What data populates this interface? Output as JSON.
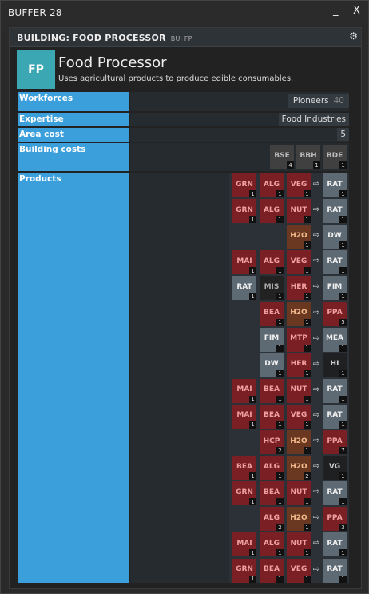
{
  "window": {
    "title": "BUFFER 28",
    "minimize": "_",
    "close": "X"
  },
  "panel": {
    "title": "BUILDING: FOOD PROCESSOR",
    "code": "BUI FP"
  },
  "building": {
    "ticker": "FP",
    "name": "Food Processor",
    "description": "Uses agricultural products to produce edible consumables."
  },
  "labels": {
    "workforces": "Workforces",
    "expertise": "Expertise",
    "area_cost": "Area cost",
    "building_costs": "Building costs",
    "products": "Products"
  },
  "workforce": {
    "name": "Pioneers",
    "count": "40"
  },
  "expertise": "Food Industries",
  "area_cost": "5",
  "building_costs": [
    {
      "t": "BSE",
      "q": "4"
    },
    {
      "t": "BBH",
      "q": "1"
    },
    {
      "t": "BDE",
      "q": "1"
    }
  ],
  "arrow": "⇨",
  "colors": {
    "agri": "#7a1f24",
    "food": "#5e6a73",
    "water": "#6a3820",
    "mis": "#222",
    "hi": "#1e2022",
    "vg": "#1e2022",
    "construction": "#404040",
    "label_bg": "#3b9fdb",
    "ticker_bg": "#3aa7b3"
  },
  "recipes": [
    {
      "inputs": [
        {
          "t": "GRN",
          "q": "1",
          "c": "agri"
        },
        {
          "t": "ALG",
          "q": "1",
          "c": "agri"
        },
        {
          "t": "VEG",
          "q": "1",
          "c": "agri"
        }
      ],
      "output": {
        "t": "RAT",
        "q": "1",
        "c": "food"
      }
    },
    {
      "inputs": [
        {
          "t": "GRN",
          "q": "1",
          "c": "agri"
        },
        {
          "t": "ALG",
          "q": "1",
          "c": "agri"
        },
        {
          "t": "NUT",
          "q": "1",
          "c": "agri"
        }
      ],
      "output": {
        "t": "RAT",
        "q": "1",
        "c": "food"
      }
    },
    {
      "inputs": [
        {
          "t": "H2O",
          "q": "1",
          "c": "water"
        }
      ],
      "output": {
        "t": "DW",
        "q": "1",
        "c": "food"
      }
    },
    {
      "inputs": [
        {
          "t": "MAI",
          "q": "1",
          "c": "agri"
        },
        {
          "t": "ALG",
          "q": "1",
          "c": "agri"
        },
        {
          "t": "VEG",
          "q": "1",
          "c": "agri"
        }
      ],
      "output": {
        "t": "RAT",
        "q": "1",
        "c": "food"
      }
    },
    {
      "inputs": [
        {
          "t": "RAT",
          "q": "1",
          "c": "food"
        },
        {
          "t": "MIS",
          "q": "1",
          "c": "mis"
        },
        {
          "t": "HER",
          "q": "1",
          "c": "agri"
        }
      ],
      "output": {
        "t": "FIM",
        "q": "1",
        "c": "food"
      }
    },
    {
      "inputs": [
        {
          "t": "BEA",
          "q": "1",
          "c": "agri"
        },
        {
          "t": "H2O",
          "q": "1",
          "c": "water"
        }
      ],
      "output": {
        "t": "PPA",
        "q": "5",
        "c": "agri"
      }
    },
    {
      "inputs": [
        {
          "t": "FIM",
          "q": "1",
          "c": "food"
        },
        {
          "t": "MTP",
          "q": "1",
          "c": "agri"
        }
      ],
      "output": {
        "t": "MEA",
        "q": "1",
        "c": "food"
      }
    },
    {
      "inputs": [
        {
          "t": "DW",
          "q": "1",
          "c": "food"
        },
        {
          "t": "HER",
          "q": "1",
          "c": "agri"
        }
      ],
      "output": {
        "t": "HI",
        "q": "1",
        "c": "hi"
      }
    },
    {
      "inputs": [
        {
          "t": "MAI",
          "q": "1",
          "c": "agri"
        },
        {
          "t": "BEA",
          "q": "1",
          "c": "agri"
        },
        {
          "t": "NUT",
          "q": "1",
          "c": "agri"
        }
      ],
      "output": {
        "t": "RAT",
        "q": "1",
        "c": "food"
      }
    },
    {
      "inputs": [
        {
          "t": "MAI",
          "q": "1",
          "c": "agri"
        },
        {
          "t": "BEA",
          "q": "1",
          "c": "agri"
        },
        {
          "t": "VEG",
          "q": "1",
          "c": "agri"
        }
      ],
      "output": {
        "t": "RAT",
        "q": "1",
        "c": "food"
      }
    },
    {
      "inputs": [
        {
          "t": "HCP",
          "q": "2",
          "c": "agri"
        },
        {
          "t": "H2O",
          "q": "1",
          "c": "water"
        }
      ],
      "output": {
        "t": "PPA",
        "q": "7",
        "c": "agri"
      }
    },
    {
      "inputs": [
        {
          "t": "BEA",
          "q": "1",
          "c": "agri"
        },
        {
          "t": "ALG",
          "q": "1",
          "c": "agri"
        },
        {
          "t": "H2O",
          "q": "2",
          "c": "water"
        }
      ],
      "output": {
        "t": "VG",
        "q": "1",
        "c": "vg"
      }
    },
    {
      "inputs": [
        {
          "t": "GRN",
          "q": "1",
          "c": "agri"
        },
        {
          "t": "BEA",
          "q": "1",
          "c": "agri"
        },
        {
          "t": "NUT",
          "q": "1",
          "c": "agri"
        }
      ],
      "output": {
        "t": "RAT",
        "q": "1",
        "c": "food"
      }
    },
    {
      "inputs": [
        {
          "t": "ALG",
          "q": "2",
          "c": "agri"
        },
        {
          "t": "H2O",
          "q": "1",
          "c": "water"
        }
      ],
      "output": {
        "t": "PPA",
        "q": "3",
        "c": "agri"
      }
    },
    {
      "inputs": [
        {
          "t": "MAI",
          "q": "1",
          "c": "agri"
        },
        {
          "t": "ALG",
          "q": "1",
          "c": "agri"
        },
        {
          "t": "NUT",
          "q": "1",
          "c": "agri"
        }
      ],
      "output": {
        "t": "RAT",
        "q": "1",
        "c": "food"
      }
    },
    {
      "inputs": [
        {
          "t": "GRN",
          "q": "1",
          "c": "agri"
        },
        {
          "t": "BEA",
          "q": "1",
          "c": "agri"
        },
        {
          "t": "VEG",
          "q": "1",
          "c": "agri"
        }
      ],
      "output": {
        "t": "RAT",
        "q": "1",
        "c": "food"
      }
    }
  ]
}
